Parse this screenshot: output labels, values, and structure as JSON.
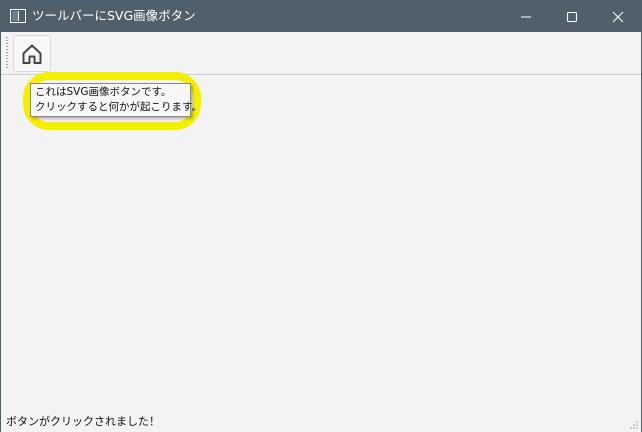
{
  "window": {
    "title": "ツールバーにSVG画像ボタン",
    "app_icon": "window-icon",
    "controls": {
      "minimize_icon": "minimize-icon",
      "maximize_icon": "maximize-icon",
      "close_icon": "close-icon"
    }
  },
  "toolbar": {
    "buttons": [
      {
        "icon": "home-icon"
      }
    ]
  },
  "tooltip": {
    "line1": "これはSVG画像ボタンです。",
    "line2": "クリックすると何かが起こります。"
  },
  "statusbar": {
    "message": "ボタンがクリックされました！"
  },
  "colors": {
    "titlebar": "#4f606c",
    "highlight": "#f4ef00",
    "background": "#f3f3f3"
  }
}
